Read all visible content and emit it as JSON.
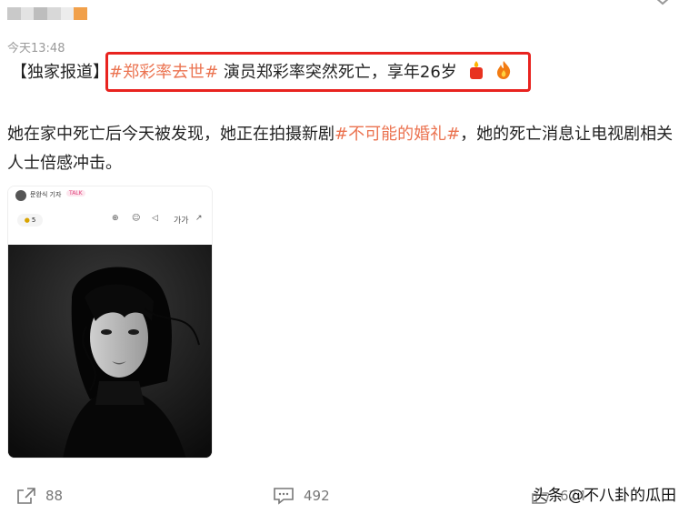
{
  "post": {
    "timestamp": "今天13:48",
    "headline_prefix": "【独家报道】",
    "headline_tag": "#郑彩率去世#",
    "headline_text": "演员郑彩率突然死亡，享年26岁",
    "body_1": "她在家中死亡后今天被发现，她正在拍摄新剧",
    "body_tag": "#不可能的婚礼#",
    "body_2": "，她的死亡消息让电视剧相关人士倍感冲击。"
  },
  "card": {
    "reporter": "문완식 기자",
    "badge": "TALK",
    "reaction_count": "5",
    "tool_font": "가가"
  },
  "actions": {
    "share_count": "88",
    "comment_count": "492",
    "like_count": "624"
  },
  "watermark": "头条 @不八卦的瓜田",
  "colors": {
    "tag": "#eb7350",
    "highlight_box": "#e8231f"
  }
}
